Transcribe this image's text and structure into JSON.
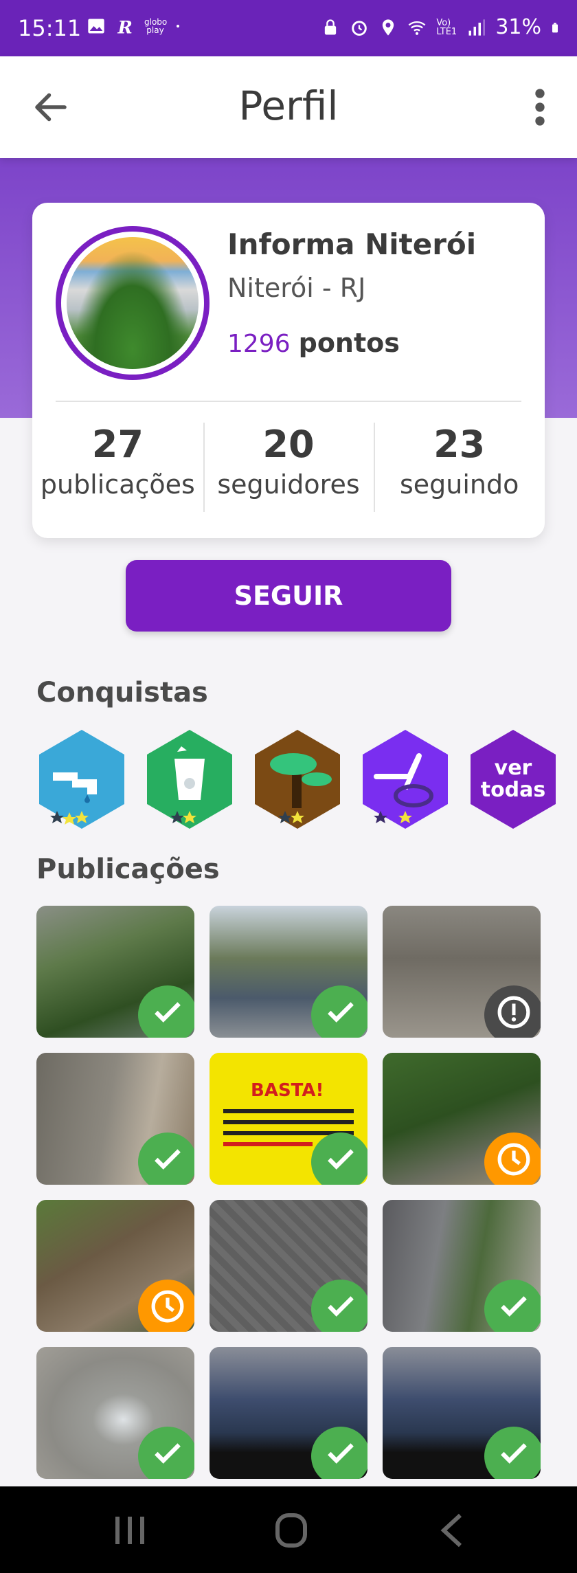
{
  "status_bar": {
    "time": "15:11",
    "battery": "31%",
    "icons_left": [
      "image-icon",
      "r-app-icon",
      "globoplay-icon",
      "dot-icon"
    ],
    "icons_right": [
      "lock-icon",
      "alarm-icon",
      "location-icon",
      "wifi-icon",
      "volte-icon",
      "signal-icon",
      "battery-icon"
    ],
    "globoplay_text": "globo play",
    "volte_text": "Vo) LTE1"
  },
  "app_bar": {
    "title": "Perfil",
    "back_icon": "arrow-left-icon",
    "menu_icon": "more-vertical-icon"
  },
  "profile": {
    "name": "Informa Niterói",
    "city": "Niterói - RJ",
    "points_value": "1296",
    "points_label": "pontos",
    "stats": [
      {
        "value": "27",
        "label": "publicações"
      },
      {
        "value": "20",
        "label": "seguidores"
      },
      {
        "value": "23",
        "label": "seguindo"
      }
    ]
  },
  "follow_button": "SEGUIR",
  "achievements": {
    "title": "Conquistas",
    "badges": [
      {
        "name": "plumbing-badge-icon",
        "color": "#3aa8d8"
      },
      {
        "name": "trash-badge-icon",
        "color": "#27ae60"
      },
      {
        "name": "tree-badge-icon",
        "color": "#7b4a14"
      },
      {
        "name": "bike-badge-icon",
        "color": "#7a2ef0"
      }
    ],
    "see_all": "ver todas"
  },
  "publications": {
    "title": "Publicações",
    "items": [
      {
        "status": "ok"
      },
      {
        "status": "ok"
      },
      {
        "status": "alert"
      },
      {
        "status": "ok"
      },
      {
        "status": "ok"
      },
      {
        "status": "pending"
      },
      {
        "status": "pending"
      },
      {
        "status": "ok"
      },
      {
        "status": "ok"
      },
      {
        "status": "ok"
      },
      {
        "status": "ok"
      },
      {
        "status": "ok"
      }
    ],
    "poster_text": "BASTA!"
  },
  "colors": {
    "brand": "#7a1fc2",
    "status_ok": "#4caf50",
    "status_pending": "#ff9800",
    "status_alert": "#4a4a4a"
  }
}
